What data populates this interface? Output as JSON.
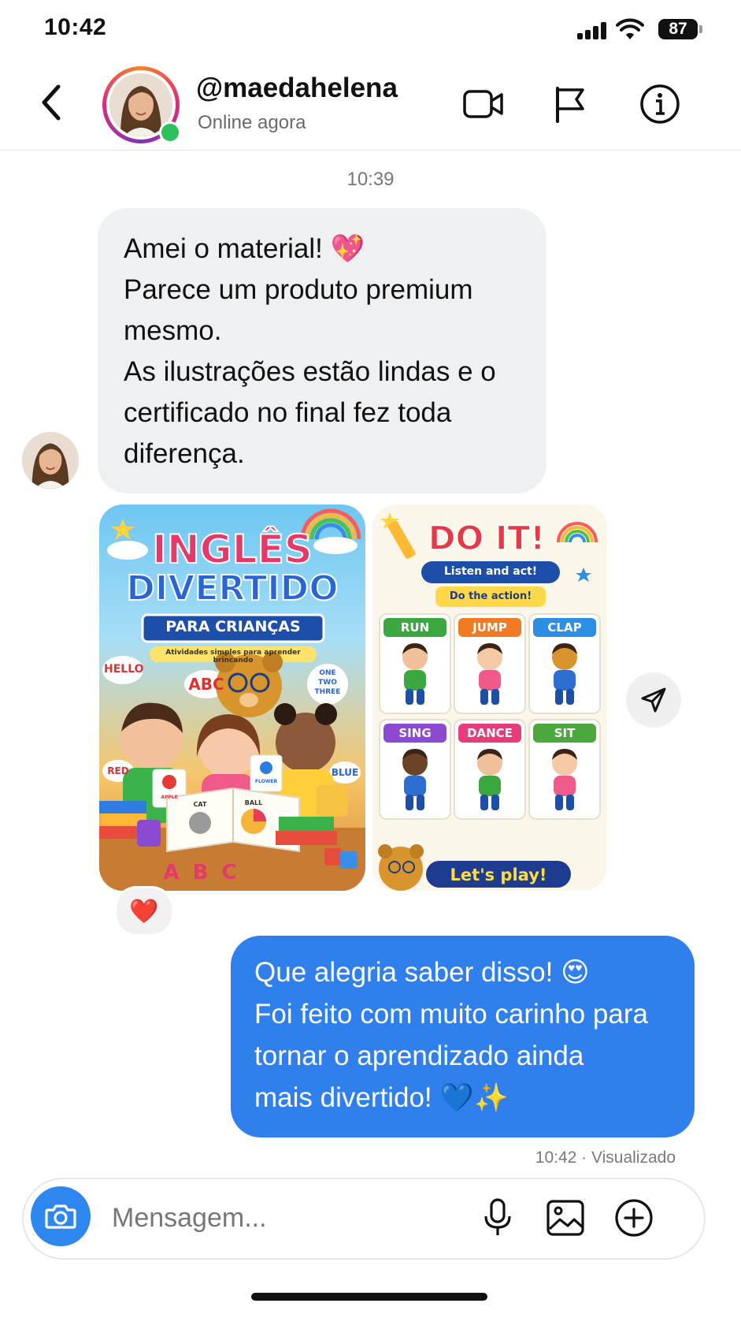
{
  "status_bar": {
    "time": "10:42",
    "battery": "87"
  },
  "header": {
    "username": "@maedahelena",
    "presence": "Online agora"
  },
  "messages": {
    "timestamp": "10:39",
    "incoming_lines": [
      "Amei o material! 💖",
      "Parece um produto premium",
      "mesmo.",
      "As ilustrações estão lindas e o",
      "certificado no final fez toda",
      "diferença."
    ],
    "reaction": "❤️",
    "outgoing_lines": [
      "Que alegria saber disso! 😍",
      "Foi feito com muito carinho para",
      "tornar o aprendizado ainda",
      "mais divertido! 💙✨"
    ],
    "seen_status": "10:42 · Visualizado"
  },
  "poster1": {
    "title_line1": "INGLÊS",
    "title_line2": "DIVERTIDO",
    "banner": "PARA CRIANÇAS",
    "subtitle": "Atividades simples para aprender brincando",
    "bubble_hello": "HELLO",
    "bubble_abc": "ABC",
    "bubble_numbers": "ONE TWO THREE",
    "bubble_red": "RED",
    "bubble_blue": "BLUE",
    "card_apple": "APPLE",
    "card_flower": "FLOWER",
    "book_cat": "CAT",
    "book_ball": "BALL",
    "floor_letters": "A B C"
  },
  "poster2": {
    "title": "DO IT!",
    "subtitle": "Listen and act!",
    "instruction": "Do the action!",
    "actions": [
      {
        "label": "RUN",
        "color": "#3aa83f"
      },
      {
        "label": "JUMP",
        "color": "#f07b22"
      },
      {
        "label": "CLAP",
        "color": "#2c8fe6"
      },
      {
        "label": "SING",
        "color": "#8b4ad1"
      },
      {
        "label": "DANCE",
        "color": "#e63d7a"
      },
      {
        "label": "SIT",
        "color": "#4ca83c"
      }
    ],
    "footer": "Let's play!"
  },
  "composer": {
    "placeholder": "Mensagem..."
  },
  "colors": {
    "outgoing_bubble": "#2f80ed",
    "incoming_bubble": "#eff0f2",
    "online": "#2ec05c"
  }
}
